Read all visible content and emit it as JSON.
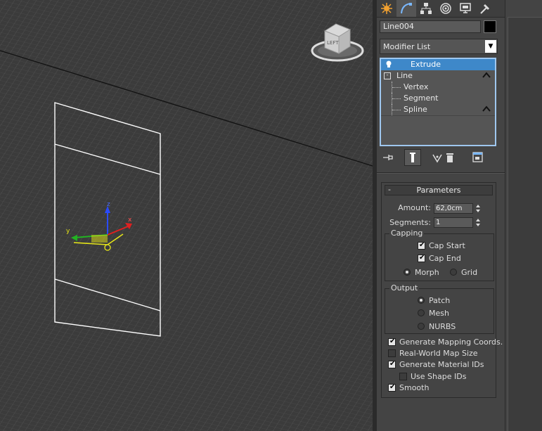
{
  "object": {
    "name": "Line004",
    "color": "#000000"
  },
  "modifier_list": {
    "label": "Modifier List"
  },
  "stack": {
    "items": [
      {
        "label": "Extrude",
        "selected": true
      },
      {
        "label": "Line"
      },
      {
        "label": "Vertex"
      },
      {
        "label": "Segment"
      },
      {
        "label": "Spline"
      }
    ]
  },
  "viewcube": {
    "face": "LEFT"
  },
  "gizmo": {
    "x": "x",
    "y": "y",
    "z": "z"
  },
  "parameters": {
    "title": "Parameters",
    "collapse": "-",
    "amount_label": "Amount:",
    "amount_value": "62,0cm",
    "segments_label": "Segments:",
    "segments_value": "1",
    "capping": {
      "title": "Capping",
      "cap_start": "Cap Start",
      "cap_end": "Cap End",
      "morph": "Morph",
      "grid": "Grid"
    },
    "output": {
      "title": "Output",
      "patch": "Patch",
      "mesh": "Mesh",
      "nurbs": "NURBS"
    },
    "generate_mapping": "Generate Mapping Coords.",
    "real_world": "Real-World Map Size",
    "generate_material": "Generate Material IDs",
    "use_shape_ids": "Use Shape IDs",
    "smooth": "Smooth"
  }
}
